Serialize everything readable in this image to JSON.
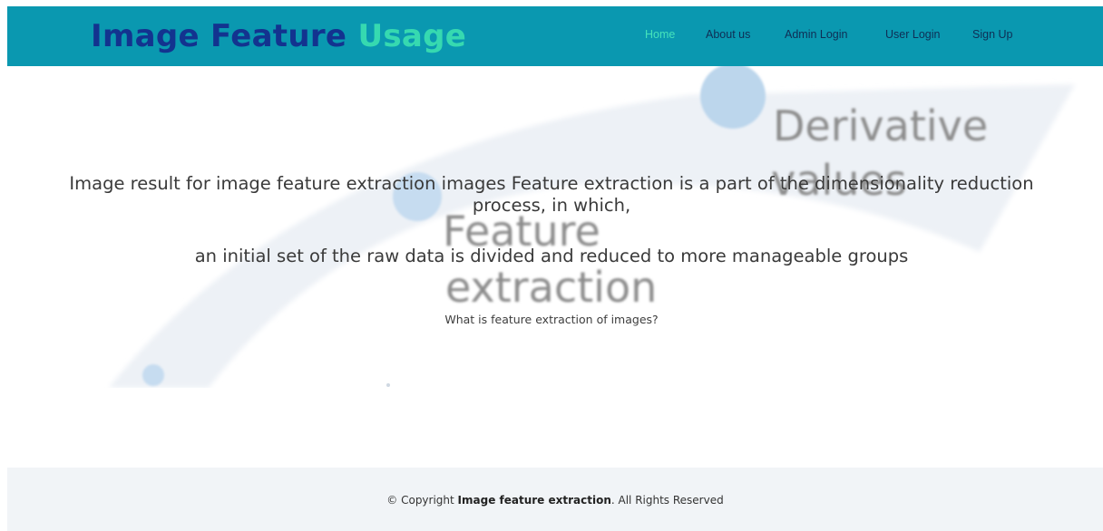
{
  "brand": {
    "part1": "Image Feature",
    "part2": "Usage"
  },
  "nav": {
    "items": [
      {
        "label": "Home",
        "active": true
      },
      {
        "label": "About us",
        "active": false
      },
      {
        "label": "Admin Login",
        "active": false
      },
      {
        "label": "User Login",
        "active": false
      },
      {
        "label": "Sign Up",
        "active": false
      }
    ]
  },
  "hero": {
    "background_words": [
      "Derivative",
      "values",
      "Feature",
      "extraction"
    ],
    "lead_line1": "Image result for image feature extraction images Feature extraction is a part of the dimensionality reduction",
    "lead_line1b": "process, in which,",
    "lead_line2": "an initial set of the raw data is divided and reduced to more manageable groups",
    "question": "What is feature extraction of images?"
  },
  "footer": {
    "prefix": "© Copyright ",
    "site": "Image feature extraction",
    "suffix": ". All Rights Reserved"
  },
  "colors": {
    "header_bg": "#0a98b0",
    "brand_dark": "#13338f",
    "brand_accent": "#36d9b0",
    "nav_text": "#0f2e55",
    "nav_active": "#46e3bb",
    "footer_bg": "#f1f4f7"
  }
}
